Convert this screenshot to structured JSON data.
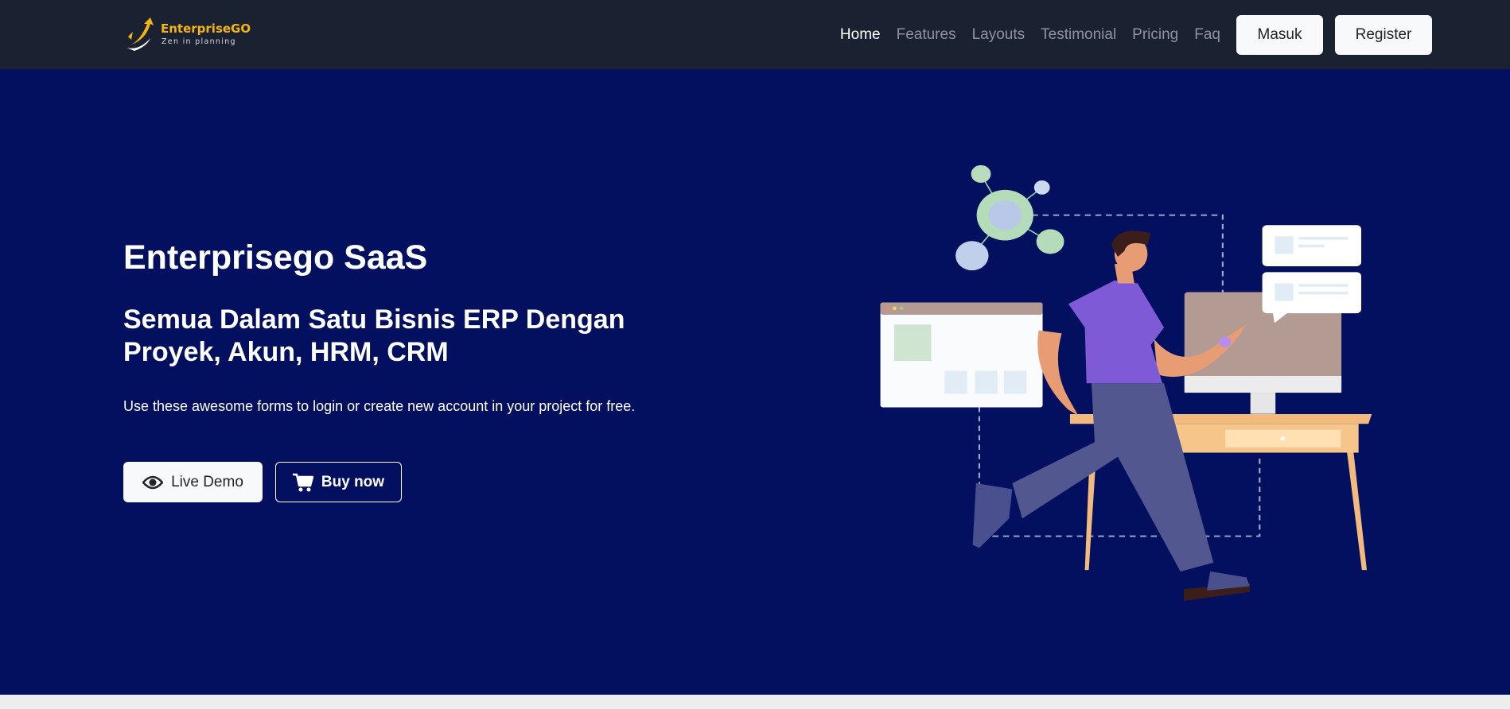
{
  "brand": {
    "name": "EnterpriseGO",
    "tagline": "Zen in planning",
    "color": "#f6b40c"
  },
  "nav": {
    "links": [
      {
        "label": "Home",
        "active": true
      },
      {
        "label": "Features"
      },
      {
        "label": "Layouts"
      },
      {
        "label": "Testimonial"
      },
      {
        "label": "Pricing"
      },
      {
        "label": "Faq"
      }
    ],
    "login_label": "Masuk",
    "register_label": "Register"
  },
  "hero": {
    "title": "Enterprisego SaaS",
    "subtitle": "Semua Dalam Satu Bisnis ERP Dengan Proyek, Akun, HRM, CRM",
    "description": "Use these awesome forms to login or create new account in your project for free.",
    "live_demo_label": "Live Demo",
    "live_demo_icon": "eye-icon",
    "buy_label": "Buy now",
    "buy_icon": "cart-icon",
    "background": "#02105f"
  }
}
